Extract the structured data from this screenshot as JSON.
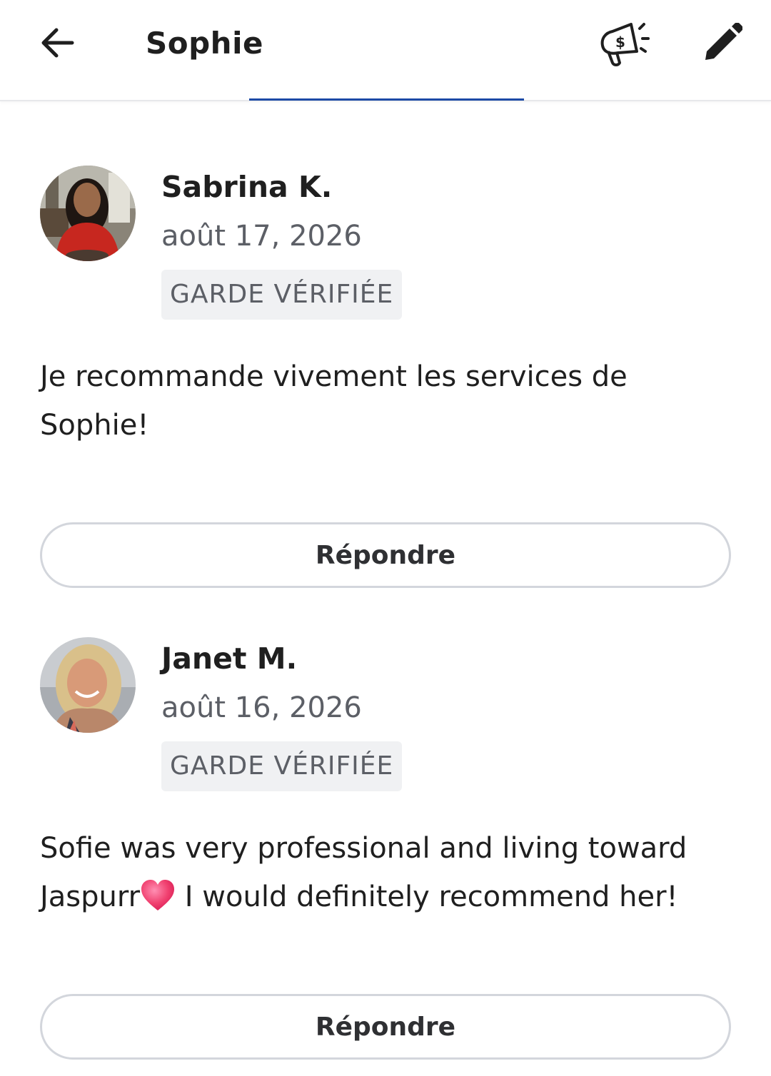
{
  "header": {
    "title": "Sophie",
    "back_icon": "arrow-left-icon",
    "promo_icon": "megaphone-dollar-icon",
    "edit_icon": "pencil-icon"
  },
  "colors": {
    "accent": "#1c4aa6",
    "badge_bg": "#f0f1f3",
    "muted_text": "#5c5f66",
    "button_border": "#d3d6dc"
  },
  "reviews": [
    {
      "name": "Sabrina K.",
      "date": "août 17, 2026",
      "badge": "GARDE VÉRIFIÉE",
      "text": "Je recommande vivement les services de Sophie!",
      "reply_label": "Répondre"
    },
    {
      "name": "Janet M.",
      "date": "août 16, 2026",
      "badge": "GARDE VÉRIFIÉE",
      "text_before": "Sofie was very professional and living toward Jaspurr",
      "emoji": "heart-emoji",
      "text_after": " I would definitely recommend her!",
      "reply_label": "Répondre"
    }
  ]
}
